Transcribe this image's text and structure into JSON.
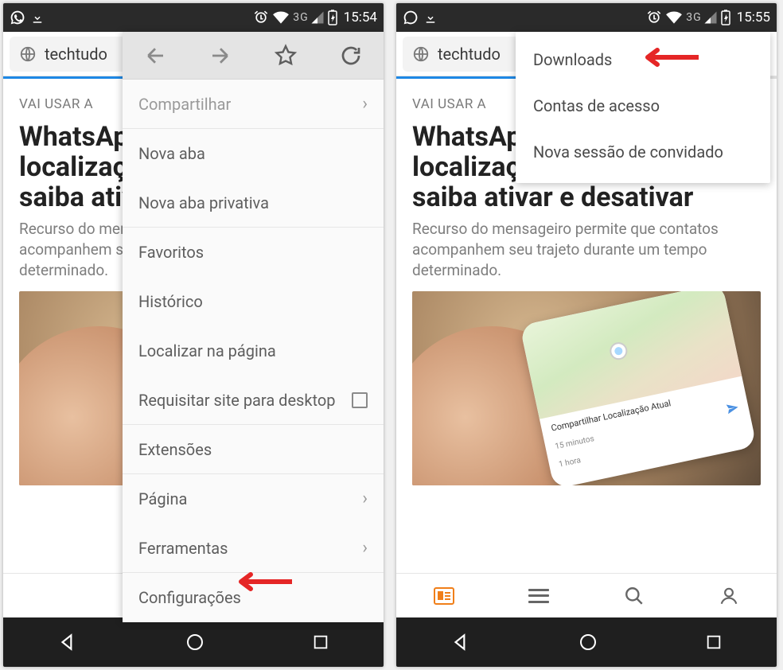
{
  "status": {
    "network": "3G",
    "time_left": "15:54",
    "time_right": "15:55"
  },
  "url_bar": {
    "text": "techtudo"
  },
  "article": {
    "category": "VAI USAR A",
    "headline": "WhatsApp libera envio de localização em tempo real; saiba ativar e desativar",
    "subhead": "Recurso do mensageiro permite que contatos acompanhem seu trajeto durante um tempo determinado.",
    "map_share": "Compartilhar Localização Atual",
    "map_time1": "15 minutos",
    "map_time2": "1 hora"
  },
  "left_menu": {
    "toolbar": {
      "back": "back",
      "forward": "forward",
      "star": "star",
      "reload": "reload"
    },
    "share": "Compartilhar",
    "new_tab": "Nova aba",
    "new_private": "Nova aba privativa",
    "favorites": "Favoritos",
    "history": "Histórico",
    "find": "Localizar na página",
    "desktop_site": "Requisitar site para desktop",
    "extensions": "Extensões",
    "page": "Página",
    "tools": "Ferramentas",
    "settings": "Configurações"
  },
  "right_menu": {
    "downloads": "Downloads",
    "accounts": "Contas de acesso",
    "guest": "Nova sessão de convidado"
  }
}
